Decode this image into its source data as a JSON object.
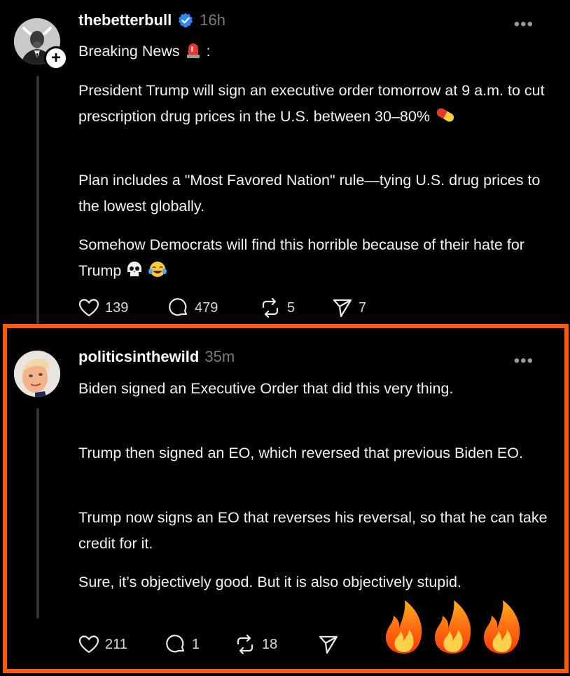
{
  "post1": {
    "username": "thebetterbull",
    "time": "16h",
    "intro": "Breaking News",
    "intro_suffix": ":",
    "paragraph1": "President Trump will sign an executive order tomorrow at 9 a.m. to cut prescription drug prices in the U.S. between 30–80%",
    "paragraph2": "Plan includes a \"Most Favored Nation\" rule—tying U.S. drug prices to the lowest globally.",
    "paragraph3": "Somehow Democrats will find this horrible because of their hate for Trump",
    "likes": "139",
    "replies": "479",
    "reposts": "5",
    "shares": "7",
    "verified": true
  },
  "post2": {
    "username": "politicsinthewild",
    "time": "35m",
    "paragraph1": "Biden signed an Executive Order that did this very thing.",
    "paragraph2": "Trump then signed an EO, which reversed that previous Biden EO.",
    "paragraph3": "Trump now signs an EO that reverses his reversal, so that he can take credit for it.",
    "paragraph4": "Sure, it’s objectively good. But it is also objectively stupid.",
    "likes": "211",
    "replies": "1",
    "reposts": "18"
  },
  "more_glyph": "•••",
  "follow_glyph": "+",
  "colors": {
    "highlight_border": "#ff5a0a",
    "verified_blue": "#2f87f0",
    "background": "#000000",
    "muted": "#7b7b7b"
  },
  "icons": [
    "heart-icon",
    "comment-icon",
    "repost-icon",
    "share-icon",
    "verified-icon",
    "siren-emoji",
    "pill-emoji",
    "skull-emoji",
    "laughing-emoji",
    "fire-emoji"
  ]
}
